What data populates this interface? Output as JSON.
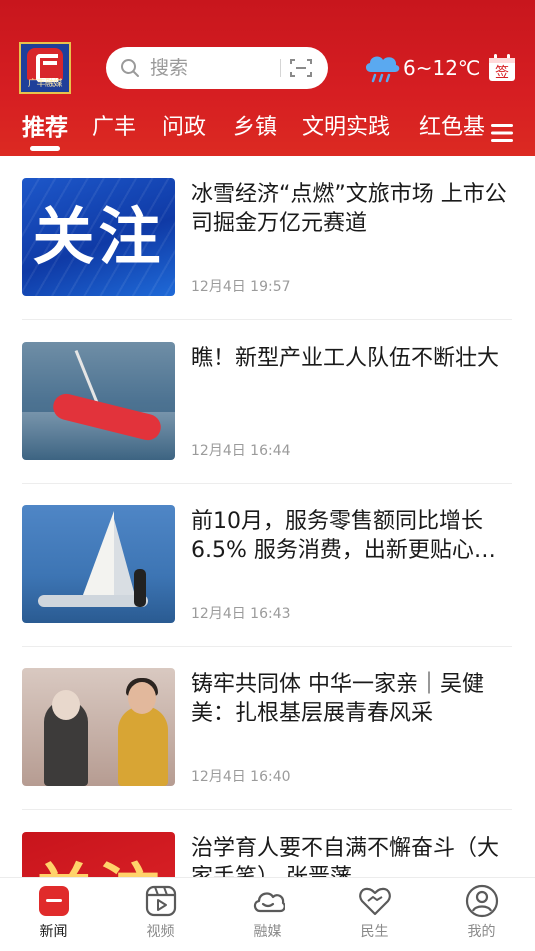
{
  "header": {
    "logo_text": "广丰融媒",
    "search_placeholder": "搜索",
    "weather_temp": "6~12℃",
    "sign_label": "签",
    "tabs": [
      {
        "label": "推荐",
        "active": true
      },
      {
        "label": "广丰",
        "active": false
      },
      {
        "label": "问政",
        "active": false
      },
      {
        "label": "乡镇",
        "active": false
      },
      {
        "label": "文明实践",
        "active": false
      },
      {
        "label": "红色基",
        "active": false
      }
    ],
    "icons": {
      "search": "search-icon",
      "scan": "scan-icon",
      "weather": "cloud-rain-icon",
      "sign": "calendar-sign-icon",
      "menu": "menu-icon"
    }
  },
  "feed": [
    {
      "title": "冰雪经济“点燃”文旅市场 上市公司掘金万亿元赛道",
      "time": "12月4日 19:57",
      "thumb_text": "关注"
    },
    {
      "title": "瞧！新型产业工人队伍不断壮大",
      "time": "12月4日 16:44"
    },
    {
      "title": "前10月，服务零售额同比增长6.5% 服务消费，出新更贴心…",
      "time": "12月4日 16:43"
    },
    {
      "title": "铸牢共同体 中华一家亲｜吴健美：扎根基层展青春风采",
      "time": "12月4日 16:40"
    },
    {
      "title": "治学育人要不自满不懈奋斗（大家手笔） 张晋藩",
      "time": "",
      "thumb_text": "关注"
    }
  ],
  "bottom_nav": [
    {
      "label": "新闻",
      "icon": "news-icon",
      "active": true
    },
    {
      "label": "视频",
      "icon": "video-icon",
      "active": false
    },
    {
      "label": "融媒",
      "icon": "cloud-media-icon",
      "active": false
    },
    {
      "label": "民生",
      "icon": "heart-handshake-icon",
      "active": false
    },
    {
      "label": "我的",
      "icon": "user-icon",
      "active": false
    }
  ],
  "colors": {
    "brand_red": "#d61e22",
    "nav_active": "#e02b2b",
    "text_primary": "#1a1a1a",
    "text_secondary": "#9b9b9b"
  }
}
